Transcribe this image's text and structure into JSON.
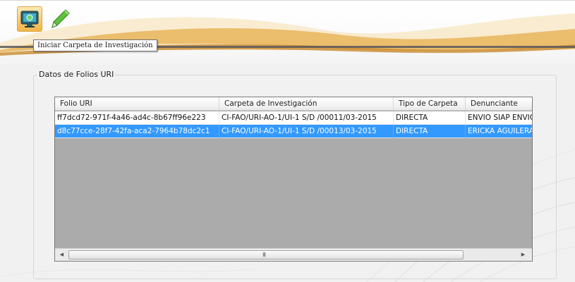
{
  "toolbar": {
    "buttons": [
      {
        "icon": "monitor-icon"
      },
      {
        "icon": "pencil-icon"
      }
    ],
    "tooltip": "Iniciar Carpeta de Investigación"
  },
  "panel": {
    "title": "Datos de Folios URI"
  },
  "grid": {
    "columns": [
      "Folio URI",
      "Carpeta de Investigación",
      "Tipo de Carpeta",
      "Denunciante"
    ],
    "rows": [
      [
        "ff7dcd72-971f-4a46-ad4c-8b67ff96e223",
        "CI-FAO/URI-AO-1/UI-1 S/D /00011/03-2015",
        "DIRECTA",
        "ENVIO SIAP ENVIO"
      ],
      [
        "d8c77cce-28f7-42fa-aca2-7964b78dc2c1",
        "CI-FAO/URI-AO-1/UI-1 S/D /00013/03-2015",
        "DIRECTA",
        "ERICKA AGUILERA"
      ]
    ],
    "selected_row": 1,
    "scrollbar": {
      "left_arrow": "◀",
      "right_arrow": "▶",
      "grip": "III"
    }
  },
  "colors": {
    "selection": "#3399ff",
    "ribbon_gold": "#e7a94d",
    "grid_empty": "#ababab"
  }
}
